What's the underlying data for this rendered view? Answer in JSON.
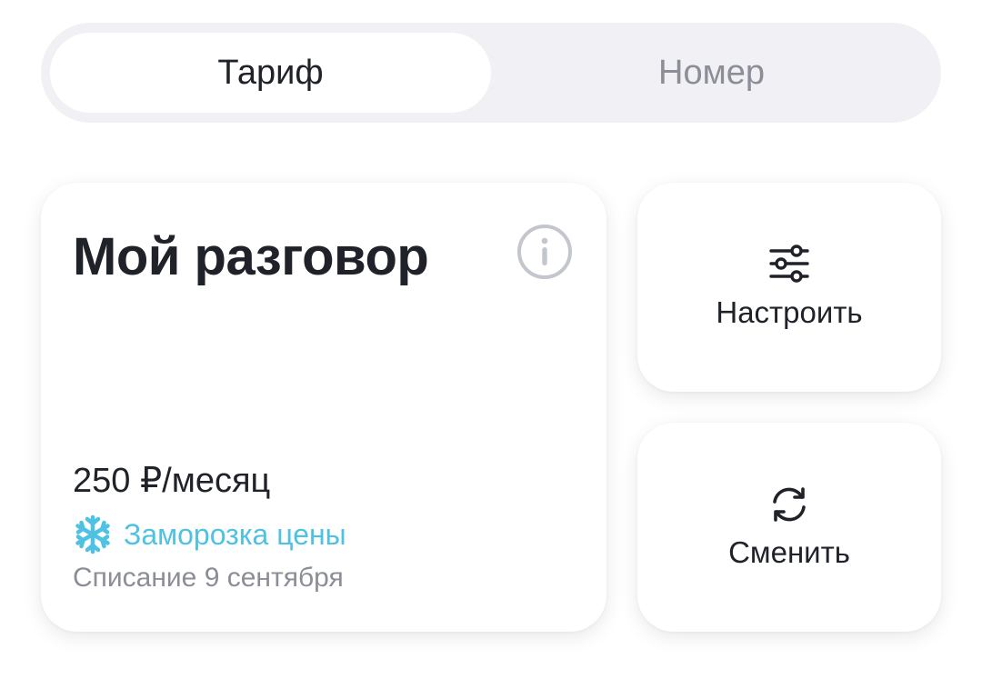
{
  "tabs": {
    "active_label": "Тариф",
    "inactive_label": "Номер"
  },
  "tariff": {
    "title": "Мой разговор",
    "price": "250 ₽/месяц",
    "freeze_label": "Заморозка цены",
    "charge_date": "Списание 9 сентября",
    "info_icon": "info-icon",
    "freeze_icon": "snowflake-icon"
  },
  "actions": {
    "configure": {
      "label": "Настроить",
      "icon": "sliders-icon"
    },
    "change": {
      "label": "Сменить",
      "icon": "refresh-icon"
    }
  },
  "colors": {
    "accent_blue": "#4fc2e3",
    "text_primary": "#1f2229",
    "text_secondary": "#8b8e96",
    "segment_bg": "#f1f1f5"
  }
}
